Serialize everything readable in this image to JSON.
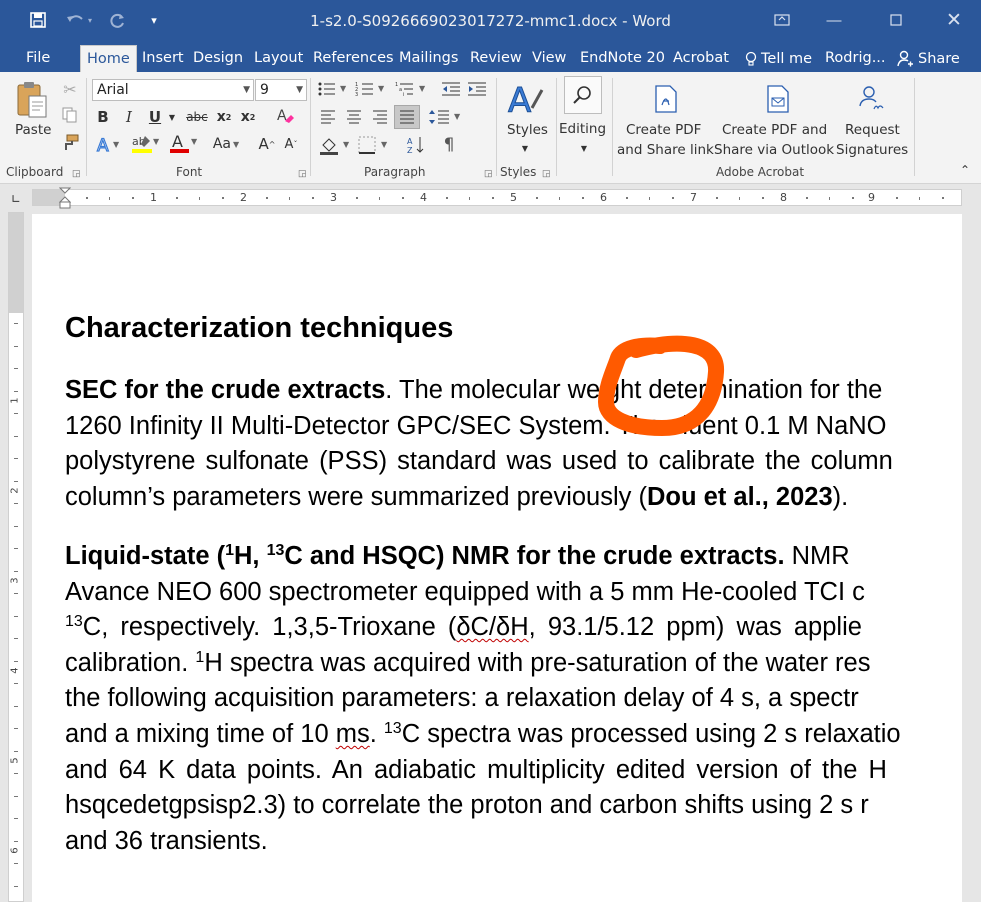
{
  "title_bar": {
    "doc_title": "1-s2.0-S0926669023017272-mmc1.docx  -  Word",
    "save_icon": "save-icon",
    "undo_icon": "undo-icon",
    "redo_icon": "redo-icon",
    "customize_icon": "customize-quick-access-icon"
  },
  "tabs": [
    "File",
    "Home",
    "Insert",
    "Design",
    "Layout",
    "References",
    "Mailings",
    "Review",
    "View",
    "EndNote 20",
    "Acrobat"
  ],
  "tell_me": "Tell me",
  "user_name": "Rodrig...",
  "share_label": "Share",
  "ribbon": {
    "clipboard": {
      "label": "Clipboard",
      "paste": "Paste"
    },
    "font": {
      "label": "Font",
      "name": "Arial",
      "size": "9",
      "bold": "B",
      "italic": "I",
      "underline": "U",
      "strike": "abc",
      "subscript": "x",
      "superscript": "x",
      "font_color_letter": "A",
      "change_case": "Aa",
      "grow": "A",
      "shrink": "A"
    },
    "paragraph": {
      "label": "Paragraph"
    },
    "styles": {
      "label": "Styles",
      "button": "Styles"
    },
    "editing": {
      "button": "Editing"
    },
    "acrobat": {
      "label": "Adobe Acrobat",
      "create_pdf": [
        "Create PDF",
        "and Share link"
      ],
      "create_pdf_outlook": [
        "Create PDF and",
        "Share via Outlook"
      ],
      "request_sig": [
        "Request",
        "Signatures"
      ]
    }
  },
  "document": {
    "heading": "Characterization techniques",
    "sec_bold": "SEC for the crude extracts",
    "sec_line1_rest": ". The molecular weight determination for the",
    "sec_line2": "1260 Infinity II Multi-Detector GPC/SEC System. The eluent 0.1 M NaNO",
    "sec_line3": "polystyrene sulfonate (PSS) standard was used to calibrate the column",
    "sec_line4_pre": "column’s parameters were summarized previously (",
    "sec_line4_cite": "Dou et al., 2023",
    "sec_line4_post": ").",
    "nmr_bold_a": "Liquid-state (",
    "nmr_sup1": "1",
    "nmr_bold_b": "H, ",
    "nmr_sup13": "13",
    "nmr_bold_c": "C and HSQC) NMR for the crude extracts.",
    "nmr_line1_rest": " NMR",
    "nmr_line2": "Avance NEO 600 spectrometer equipped with a 5 mm He-cooled TCI c",
    "nmr_line3_sup": "13",
    "nmr_line3_a": "C, respectively. 1,3,5-Trioxane (",
    "nmr_line3_sq1": "δC/δH",
    "nmr_line3_b": ", 93.1/5.12 ppm) was applie",
    "nmr_line4_a": "calibration. ",
    "nmr_line4_sup": "1",
    "nmr_line4_b": "H spectra was acquired with pre-saturation of the water res",
    "nmr_line5": "the following acquisition parameters: a relaxation delay of 4 s, a spectr",
    "nmr_line6_a": "and a mixing time of 10 ",
    "nmr_line6_sq": "ms",
    "nmr_line6_b": ". ",
    "nmr_line6_sup": "13",
    "nmr_line6_c": "C spectra was processed using 2 s relaxatio",
    "nmr_line7": "and 64 K data points. An adiabatic multiplicity edited version of the H",
    "nmr_line8": "hsqcedetgpsisp2.3) to correlate the proton and carbon shifts using 2 s r",
    "nmr_line9": "and 36 transients."
  },
  "ruler_numbers": [
    "1",
    "2",
    "3",
    "4",
    "5",
    "6",
    "7",
    "8",
    "9"
  ],
  "vruler_numbers": [
    "1",
    "2",
    "3",
    "4",
    "5",
    "6"
  ],
  "colors": {
    "word_blue": "#2b579a",
    "annotation": "#ff5a00"
  }
}
